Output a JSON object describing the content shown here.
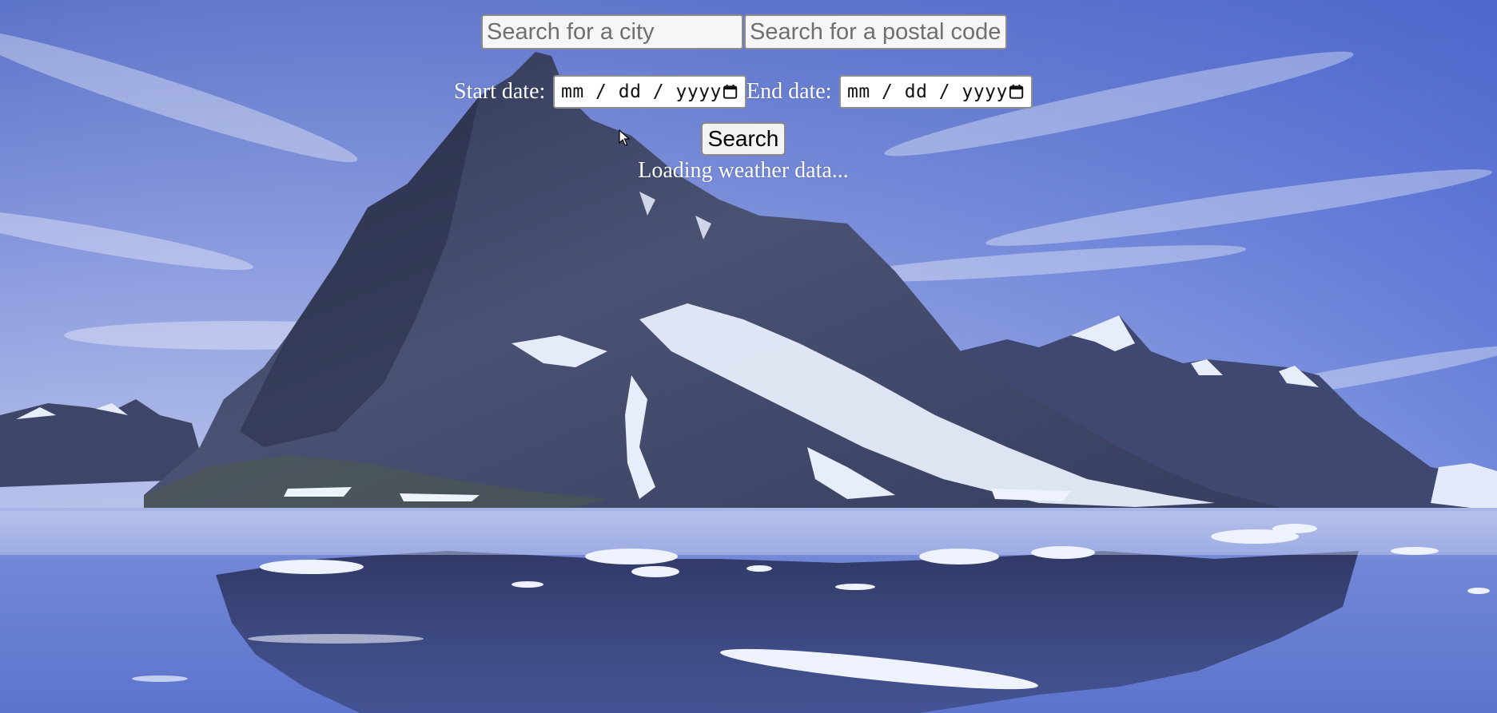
{
  "search": {
    "city_placeholder": "Search for a city",
    "city_value": "",
    "postal_placeholder": "Search for a postal code",
    "postal_value": ""
  },
  "dates": {
    "start_label": "Start date:",
    "start_value": "mm / dd / yyyy",
    "end_label": "End date:",
    "end_value": "mm / dd / yyyy",
    "calendar_icon": "calendar-icon"
  },
  "actions": {
    "search_label": "Search"
  },
  "status": {
    "message": "Loading weather data..."
  },
  "colors": {
    "sky": "#6f86d6",
    "mountain": "#3a4265",
    "snow": "#e9eefb",
    "water": "#6a7fd0",
    "text": "#ffffff"
  }
}
